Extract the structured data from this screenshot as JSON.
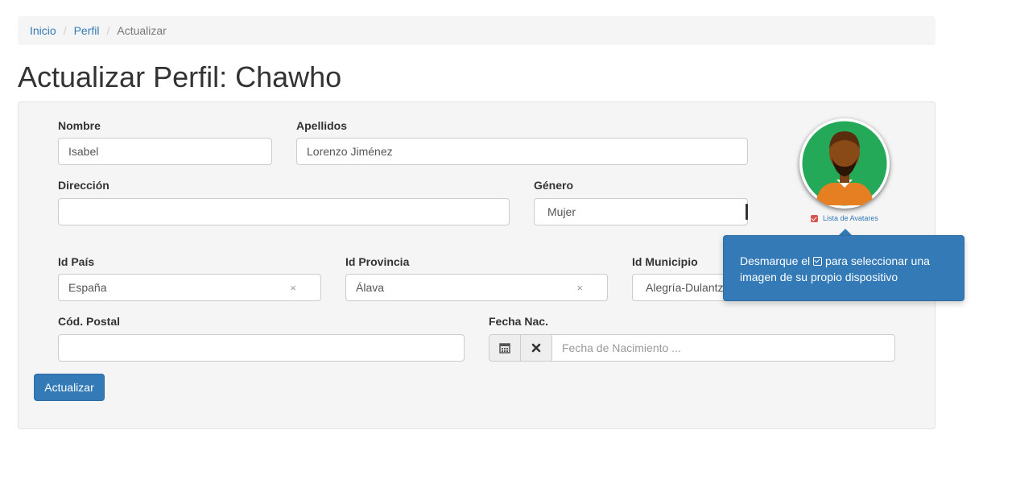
{
  "breadcrumb": {
    "items": [
      {
        "label": "Inicio"
      },
      {
        "label": "Perfil"
      }
    ],
    "separator": "/",
    "active": "Actualizar"
  },
  "page": {
    "title": "Actualizar Perfil: Chawho"
  },
  "form": {
    "nombre": {
      "label": "Nombre",
      "value": "Isabel"
    },
    "apellidos": {
      "label": "Apellidos",
      "value": "Lorenzo Jiménez"
    },
    "direccion": {
      "label": "Dirección",
      "value": ""
    },
    "genero": {
      "label": "Género",
      "value": "Mujer"
    },
    "pais": {
      "label": "Id País",
      "value": "España",
      "clear": "×"
    },
    "provincia": {
      "label": "Id Provincia",
      "value": "Álava",
      "clear": "×"
    },
    "municipio": {
      "label": "Id Municipio",
      "value": "Alegría-Dulantzi"
    },
    "postal": {
      "label": "Cód. Postal",
      "value": ""
    },
    "fecha": {
      "label": "Fecha Nac.",
      "placeholder": "Fecha de Nacimiento ..."
    },
    "submit_label": "Actualizar"
  },
  "avatar": {
    "checkbox_label": "Lista de Avatares",
    "checked": true
  },
  "popover": {
    "text_before": "Desmarque el",
    "text_after": "para seleccionar una imagen de su propio dispositivo"
  },
  "colors": {
    "primary": "#337ab7",
    "panel_bg": "#f5f5f5",
    "avatar_bg": "#24a959",
    "avatar_shirt": "#e67e22",
    "avatar_skin": "#8a4a17"
  },
  "icons": {
    "calendar": "calendar-icon",
    "remove": "remove-icon",
    "check_square": "check-square-icon"
  }
}
